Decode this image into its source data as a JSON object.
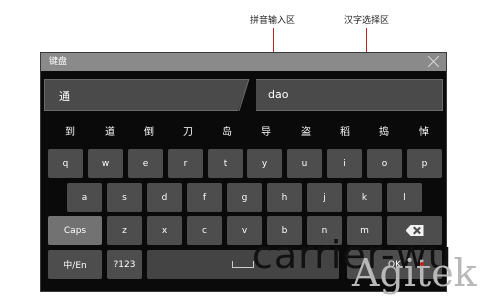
{
  "annotations": {
    "pinyin_area": "拼音输入区",
    "hanzi_area": "汉字选择区"
  },
  "window": {
    "title": "键盘"
  },
  "input": {
    "candidate_value": "通",
    "pinyin_value": "dao"
  },
  "candidates": [
    "到",
    "道",
    "倒",
    "刀",
    "岛",
    "导",
    "盗",
    "稻",
    "捣",
    "悼"
  ],
  "keys": {
    "row1": [
      "q",
      "w",
      "e",
      "r",
      "t",
      "y",
      "u",
      "i",
      "o",
      "p"
    ],
    "row2": [
      "a",
      "s",
      "d",
      "f",
      "g",
      "h",
      "j",
      "k",
      "l"
    ],
    "row3": [
      "z",
      "x",
      "c",
      "v",
      "b",
      "n",
      "m"
    ],
    "caps": "Caps",
    "lang": "中/En",
    "num": "?123",
    "ok": "OK"
  },
  "watermark": {
    "text1": "carrier-wu",
    "text2": "Agitek"
  },
  "colors": {
    "accent": "#c81e1e",
    "key": "#4d4d4d",
    "panel": "#0a0a0a"
  }
}
